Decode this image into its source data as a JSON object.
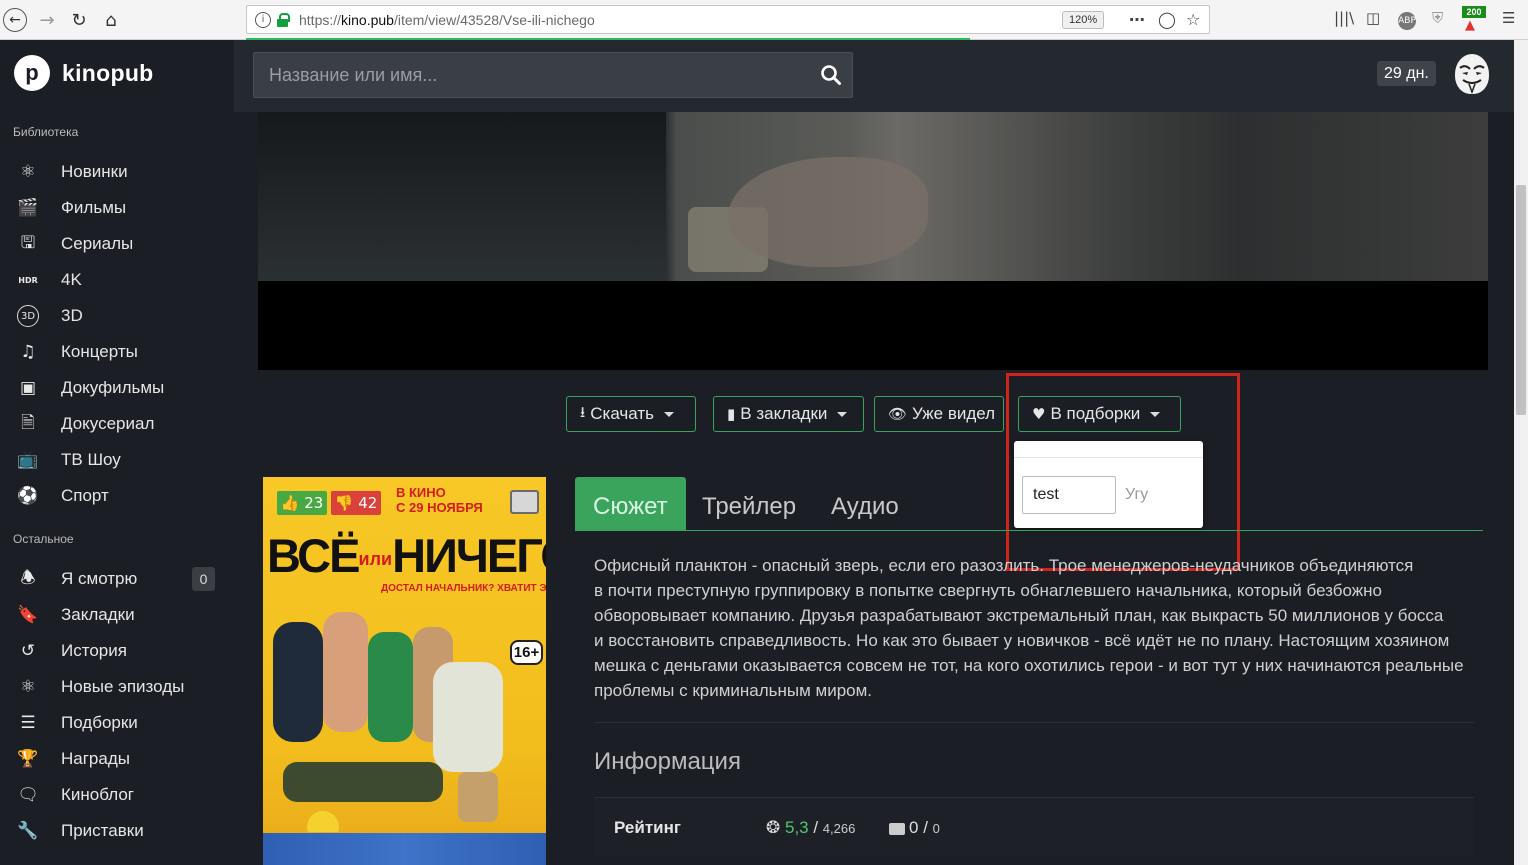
{
  "browser": {
    "url_host": "kino.pub",
    "url_prefix": "https://",
    "url_path": "/item/view/43528/Vse-ili-nichego",
    "zoom": "120%",
    "addon_badge": "200"
  },
  "brand": {
    "logo_letter": "p",
    "name": "kinopub"
  },
  "sidebar": {
    "library_title": "Библиотека",
    "library": [
      {
        "label": "Новинки",
        "icon": "new-icon"
      },
      {
        "label": "Фильмы",
        "icon": "film-icon"
      },
      {
        "label": "Сериалы",
        "icon": "tv-icon"
      },
      {
        "label": "4K",
        "icon": "hdr-icon"
      },
      {
        "label": "3D",
        "icon": "3d-icon"
      },
      {
        "label": "Концерты",
        "icon": "music-icon"
      },
      {
        "label": "Докуфильмы",
        "icon": "docfilm-icon"
      },
      {
        "label": "Докусериал",
        "icon": "document-icon"
      },
      {
        "label": "ТВ Шоу",
        "icon": "tv-show-icon"
      },
      {
        "label": "Спорт",
        "icon": "soccer-ball-icon"
      }
    ],
    "other_title": "Остальное",
    "other": [
      {
        "label": "Я смотрю",
        "icon": "bell-icon",
        "count": "0"
      },
      {
        "label": "Закладки",
        "icon": "bookmark-icon"
      },
      {
        "label": "История",
        "icon": "history-icon"
      },
      {
        "label": "Новые эпизоды",
        "icon": "new-episodes-icon"
      },
      {
        "label": "Подборки",
        "icon": "list-icon"
      },
      {
        "label": "Награды",
        "icon": "trophy-icon"
      },
      {
        "label": "Киноблог",
        "icon": "chat-icon"
      },
      {
        "label": "Приставки",
        "icon": "wrench-icon"
      }
    ]
  },
  "header": {
    "search_placeholder": "Название или имя...",
    "subscription_days": "29 дн."
  },
  "actions": {
    "download": "Скачать",
    "bookmark": "В закладки",
    "watched": "Уже видел",
    "collections": "В подборки"
  },
  "collections_dropdown": {
    "input_value": "test",
    "submit_label": "Угу"
  },
  "poster": {
    "likes": "23",
    "dislikes": "42",
    "top_note_1": "В КИНО",
    "top_note_2": "С 29 НОЯБРЯ",
    "title_part1": "ВСЁ",
    "title_or": "или",
    "title_part2": "НИЧЕГО",
    "tagline": "ДОСТАЛ НАЧАЛЬНИК? ХВАТИТ ЭТО ТЕРПЕТЬ!",
    "age": "16+"
  },
  "tabs": [
    {
      "label": "Сюжет",
      "active": true
    },
    {
      "label": "Трейлер",
      "active": false
    },
    {
      "label": "Аудио",
      "active": false
    }
  ],
  "description": [
    "Офисный планктон - опасный зверь, если его разозлить. Трое менеджеров-неудачников объединяются",
    "в почти преступную группировку в попытке свергнуть обнаглевшего начальника, который безбожно",
    "обворовывает компанию. Друзья разрабатывают экстремальный план, как выкрасть 50 миллионов у босса",
    "и восстановить справедливость. Но как это бывает у новичков - всё идёт не по плану. Настоящим хозяином",
    "мешка с деньгами оказывается совсем не тот, на кого охотились герои - и вот тут у них начинаются реальные",
    "проблемы с криминальным миром."
  ],
  "info": {
    "title": "Информация",
    "rating_label": "Рейтинг",
    "kp_value": "5,3",
    "kp_sep": " / ",
    "kp_votes": "4,266",
    "imdb_value": "0",
    "imdb_sep": " / ",
    "imdb_votes": "0"
  },
  "colors": {
    "accent_green": "#3aa35c",
    "highlight_red": "#d0241b",
    "sidebar_bg": "#1b1e25",
    "header_bg": "#24282f"
  }
}
